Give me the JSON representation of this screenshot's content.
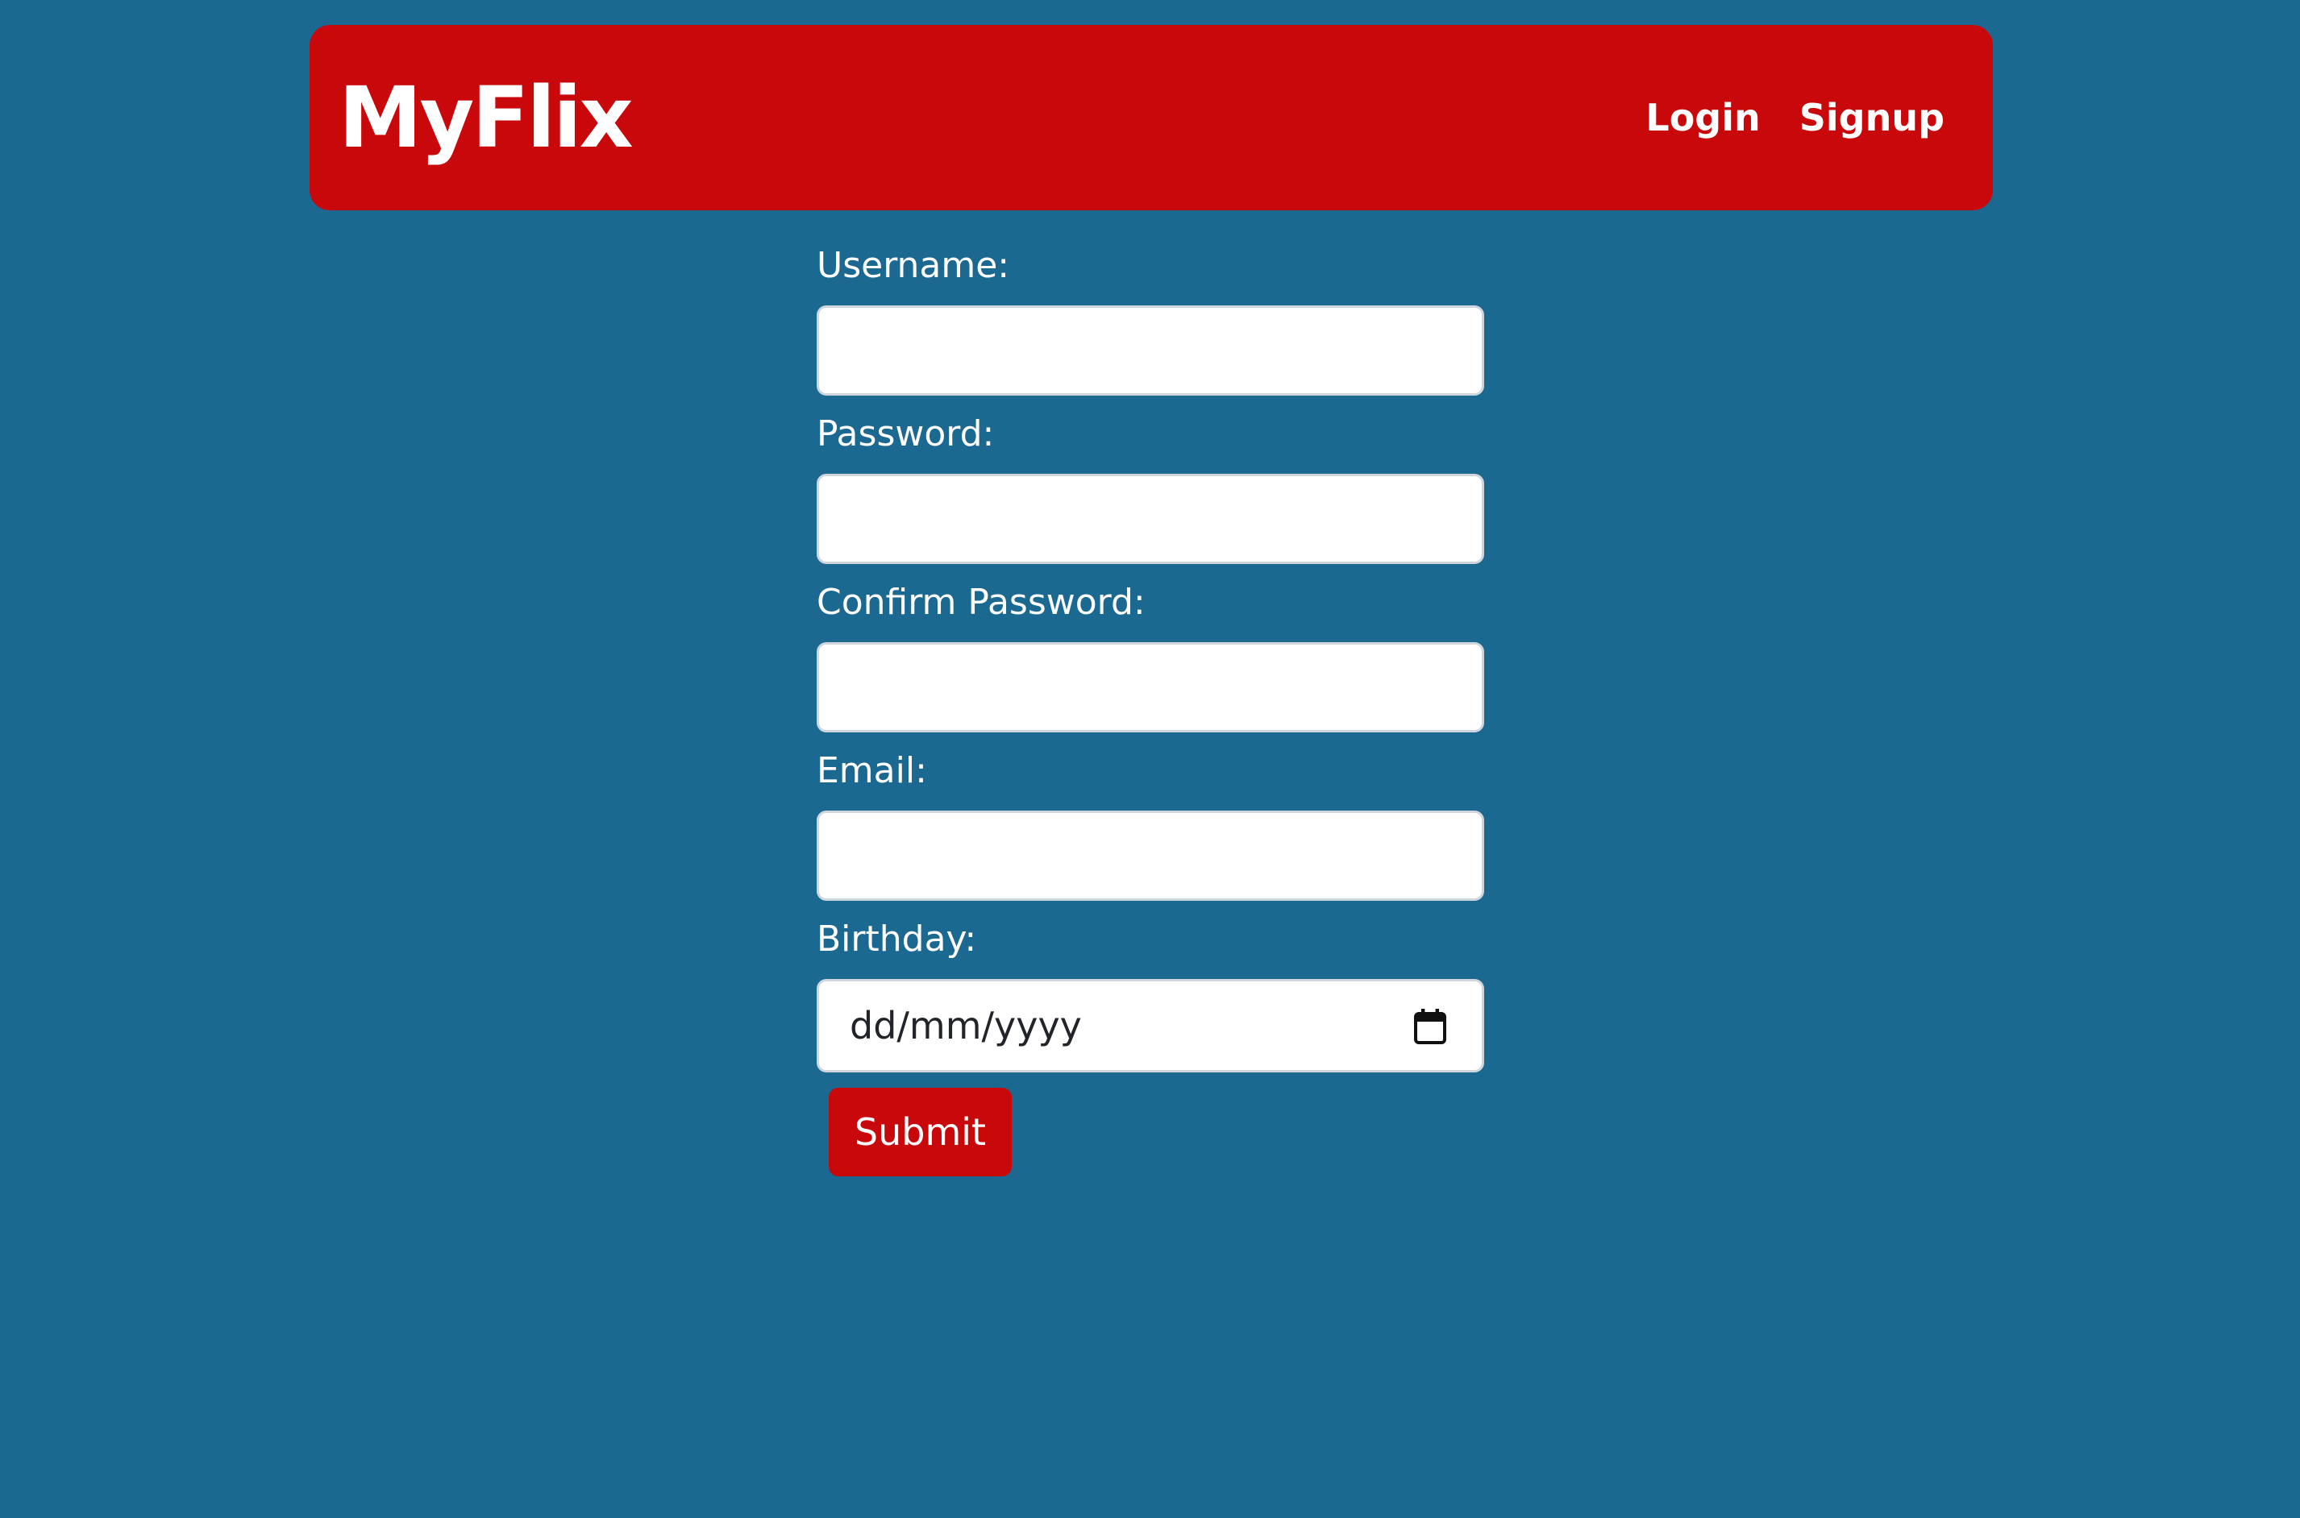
{
  "navbar": {
    "brand": "MyFlix",
    "links": [
      {
        "label": "Login"
      },
      {
        "label": "Signup"
      }
    ]
  },
  "form": {
    "fields": [
      {
        "label": "Username:",
        "value": "",
        "type": "text"
      },
      {
        "label": "Password:",
        "value": "",
        "type": "password"
      },
      {
        "label": "Confirm Password:",
        "value": "",
        "type": "password"
      },
      {
        "label": "Email:",
        "value": "",
        "type": "email"
      },
      {
        "label": "Birthday:",
        "placeholder": "dd/mm/yyyy",
        "type": "date"
      }
    ],
    "submit_label": "Submit"
  },
  "icons": {
    "birthday_picker": "calendar-icon"
  },
  "colors": {
    "background": "#1b6890",
    "accent": "#c8080b",
    "input_background": "#ffffff",
    "text": "#ffffff"
  }
}
